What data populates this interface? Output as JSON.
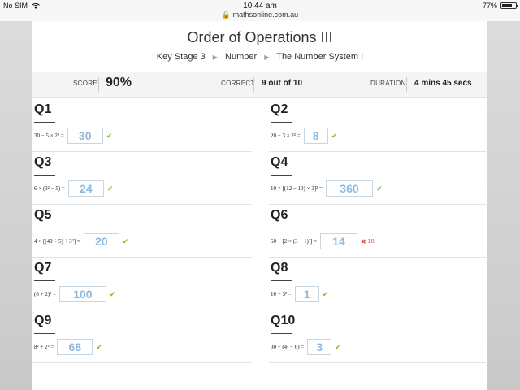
{
  "status_bar": {
    "carrier": "No SIM",
    "time": "10:44 am",
    "url": "mathsonline.com.au",
    "battery": "77%",
    "battery_level": 0.77
  },
  "page": {
    "title": "Order of Operations III",
    "breadcrumb": [
      "Key Stage 3",
      "Number",
      "The Number System I"
    ]
  },
  "summary": {
    "score_label": "SCORE",
    "score_value": "90%",
    "correct_label": "CORRECT",
    "correct_value": "9 out of 10",
    "duration_label": "DURATION",
    "duration_value": "4 mins 45 secs"
  },
  "questions": [
    {
      "label": "Q1",
      "expr": "30 − 5 × 2² =",
      "answer": "30",
      "correct": true
    },
    {
      "label": "Q2",
      "expr": "20 − 3 × 2² =",
      "answer": "8",
      "correct": true
    },
    {
      "label": "Q3",
      "expr": "6 × (3² − 5) =",
      "answer": "24",
      "correct": true
    },
    {
      "label": "Q4",
      "expr": "10 × [(12 − 10) × 3]² =",
      "answer": "360",
      "correct": true
    },
    {
      "label": "Q5",
      "expr": "4 × [(40 ÷ 5) ÷ 3²] =",
      "answer": "20",
      "correct": true
    },
    {
      "label": "Q6",
      "expr": "50 − [2 × (3 + 1)²] =",
      "answer": "14",
      "correct": false,
      "correction": "18"
    },
    {
      "label": "Q7",
      "expr": "(8 + 2)² =",
      "answer": "100",
      "correct": true
    },
    {
      "label": "Q8",
      "expr": "10 − 3² =",
      "answer": "1",
      "correct": true
    },
    {
      "label": "Q9",
      "expr": "8² + 2² =",
      "answer": "68",
      "correct": true
    },
    {
      "label": "Q10",
      "expr": "30 ÷ (4² − 6) =",
      "answer": "3",
      "correct": true
    }
  ],
  "icons": {
    "check": "check-icon",
    "cross": "cross-icon",
    "lock": "lock-icon",
    "wifi": "wifi-icon",
    "breadcrumb_sep": "triangle-right-icon"
  },
  "colors": {
    "answer_text": "#8fb9dc",
    "correct_mark": "#7fbf2a",
    "wrong_mark": "#d9534f"
  }
}
